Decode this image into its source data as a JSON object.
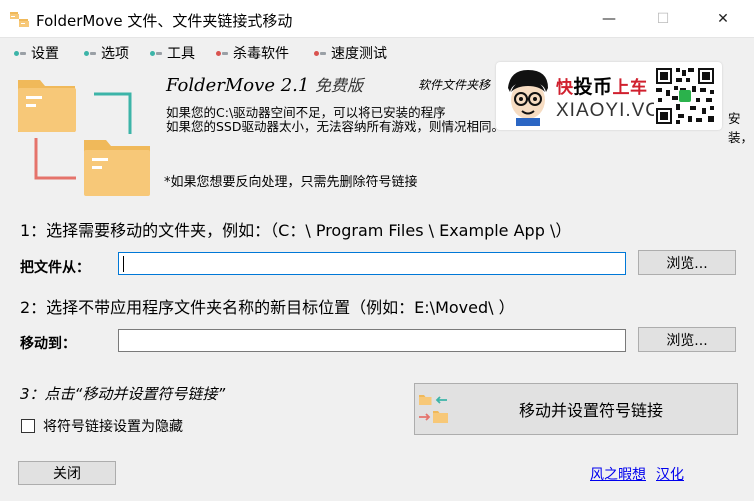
{
  "window": {
    "title": "FolderMove 文件、文件夹链接式移动",
    "min_glyph": "—",
    "max_glyph": "☐",
    "close_glyph": "✕"
  },
  "menu": [
    {
      "label": "设置",
      "colors": [
        "#3cb4a8",
        "#9aa0a6",
        "#2e7d5b"
      ]
    },
    {
      "label": "选项",
      "colors": [
        "#3cb4a8",
        "#9aa0a6",
        "#2e7d5b"
      ]
    },
    {
      "label": "工具",
      "colors": [
        "#3cb4a8",
        "#9aa0a6",
        "#2e7d5b"
      ]
    },
    {
      "label": "杀毒软件",
      "colors": [
        "#d9534f",
        "#9aa0a6",
        "#2e7d5b"
      ]
    },
    {
      "label": "速度测试",
      "colors": [
        "#d9534f",
        "#9aa0a6",
        "#2e7d5b"
      ]
    }
  ],
  "header": {
    "app_name": "FolderMove 2.1 ",
    "app_edition": "免费版",
    "author_note": "软件文件夹移",
    "desc_line1": "如果您的C:\\驱动器空间不足，可以将已安装的程序",
    "desc_line1_tail": "安装，",
    "desc_line2": "如果您的SSD驱动器太小，无法容纳所有游戏，则情况相同。",
    "reverse_note": "*如果您想要反向处理，只需先删除符号链接"
  },
  "watermark": {
    "cn_prefix": "快",
    "cn_big": "投币",
    "cn_suffix": "上车",
    "en": "XIAOYI.VC"
  },
  "step1": {
    "label": "1：选择需要移动的文件夹，例如：（C：\\ Program Files \\ Example App \\）",
    "field_label": "把文件从：",
    "value": "",
    "browse": "浏览..."
  },
  "step2": {
    "label": "2：选择不带应用程序文件夹名称的新目标位置（例如：E:\\Moved\\ ）",
    "field_label": "移动到：",
    "value": "",
    "browse": "浏览..."
  },
  "step3": {
    "label": "3：点击“移动并设置符号链接”",
    "hide_checkbox_label": "将符号链接设置为隐藏",
    "hide_checked": false,
    "action_button": "移动并设置符号链接"
  },
  "footer": {
    "close_button": "关闭",
    "credit_link": "风之暇想",
    "localize_link": "汉化"
  },
  "colors": {
    "folder": "#f7c878",
    "folder_tab": "#f0b95a",
    "arrow_green": "#3cb4a8",
    "arrow_red": "#e5736b",
    "link": "#0000ee",
    "focus": "#0078d7"
  }
}
